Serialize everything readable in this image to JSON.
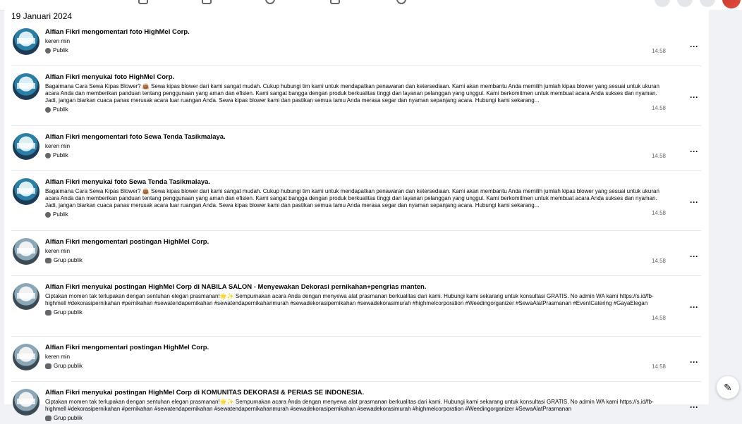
{
  "date_heading": "19 Januari 2024",
  "compose_icon": "✎",
  "activities": [
    {
      "title": "Alfian Fikri mengomentari foto HighMel Corp.",
      "text": "keren min",
      "audience": "Publik",
      "audience_icon": "globe-icon",
      "time": "14.58",
      "thumb": "tenda"
    },
    {
      "title": "Alfian Fikri menyukai foto HighMel Corp.",
      "text": "Bagaimana Cara Sewa Kipas Blower? 👜 Sewa kipas blower dari kami sangat mudah. Cukup hubungi tim kami untuk mendapatkan penawaran dan ketersediaan. Kami akan membantu Anda memilih jumlah kipas blower yang sesuai untuk ukuran acara Anda dan memberikan panduan tentang penggunaan yang aman dan efisien. Kami sangat bangga dengan produk berkualitas tinggi dan layanan pelanggan yang unggul. Kami berkomitmen untuk membuat acara Anda sukses dan nyaman. Jadi, jangan biarkan cuaca panas merusak acara luar ruangan Anda. Sewa kipas blower kami dan pastikan semua tamu Anda merasa segar dan nyaman sepanjang acara. Hubungi kami sekarang...",
      "audience": "Publik",
      "audience_icon": "globe-icon",
      "time": "14.58",
      "thumb": "tenda"
    },
    {
      "title": "Alfian Fikri mengomentari foto Sewa Tenda Tasikmalaya.",
      "text": "keren min",
      "audience": "Publik",
      "audience_icon": "globe-icon",
      "time": "14.58",
      "thumb": "tenda"
    },
    {
      "title": "Alfian Fikri menyukai foto Sewa Tenda Tasikmalaya.",
      "text": "Bagaimana Cara Sewa Kipas Blower? 👜 Sewa kipas blower dari kami sangat mudah. Cukup hubungi tim kami untuk mendapatkan penawaran dan ketersediaan. Kami akan membantu Anda memilih jumlah kipas blower yang sesuai untuk ukuran acara Anda dan memberikan panduan tentang penggunaan yang aman dan efisien. Kami sangat bangga dengan produk berkualitas tinggi dan layanan pelanggan yang unggul. Kami berkomitmen untuk membuat acara Anda sukses dan nyaman. Jadi, jangan biarkan cuaca panas merusak acara luar ruangan Anda. Sewa kipas blower kami dan pastikan semua tamu Anda merasa segar dan nyaman sepanjang acara. Hubungi kami sekarang...",
      "audience": "Publik",
      "audience_icon": "globe-icon",
      "time": "14.58",
      "thumb": "tenda"
    },
    {
      "title": "Alfian Fikri mengomentari postingan HighMel Corp.",
      "text": "keren min",
      "audience": "Grup publik",
      "audience_icon": "group-icon",
      "time": "14.58",
      "thumb": "corp"
    },
    {
      "title": "Alfian Fikri menyukai postingan HighMel Corp di NABILA SALON - Menyewakan Dekorasi pernikahan+pengrias manten.",
      "text": "Ciptakan momen tak terlupakan dengan sentuhan elegan prasmanan!🌟✨ Sempurnakan acara Anda dengan menyewa alat prasmanan berkualitas dari kami. Hubungi kami sekarang untuk konsultasi GRATIS. No admin WA kami https://s.id/fb-highmell #dekorasipernikahan #pernikahan #sewatendapernikahan #sewatendapernikahanmurah #sewadekorasipernikahan #sewadekorasimurah #highmelcorporation #Weedingorganizer #SewaAlatPrasmanan #EventCatering #GayaElegan",
      "audience": "Grup publik",
      "audience_icon": "group-icon",
      "time": "14.58",
      "thumb": "corp"
    },
    {
      "title": "Alfian Fikri mengomentari postingan HighMel Corp.",
      "text": "keren min",
      "audience": "Grup publik",
      "audience_icon": "group-icon",
      "time": "14.58",
      "thumb": "corp"
    },
    {
      "title": "Alfian Fikri menyukai postingan HighMel Corp di KOMUNITAS DEKORASI & PERIAS SE INDONESIA.",
      "text": "Ciptakan momen tak terlupakan dengan sentuhan elegan prasmanan!🌟✨ Sempurnakan acara Anda dengan menyewa alat prasmanan berkualitas dari kami. Hubungi kami sekarang untuk konsultasi GRATIS. No admin WA kami https://s.id/fb-highmell #dekorasipernikahan #pernikahan #sewatendapernikahan #sewatendapernikahanmurah #sewadekorasipernikahan #sewadekorasimurah #highmelcorporation #Weedingorganizer #SewaAlatPrasmanan",
      "audience": "Grup publik",
      "audience_icon": "group-icon",
      "time": "",
      "thumb": "corp"
    }
  ]
}
